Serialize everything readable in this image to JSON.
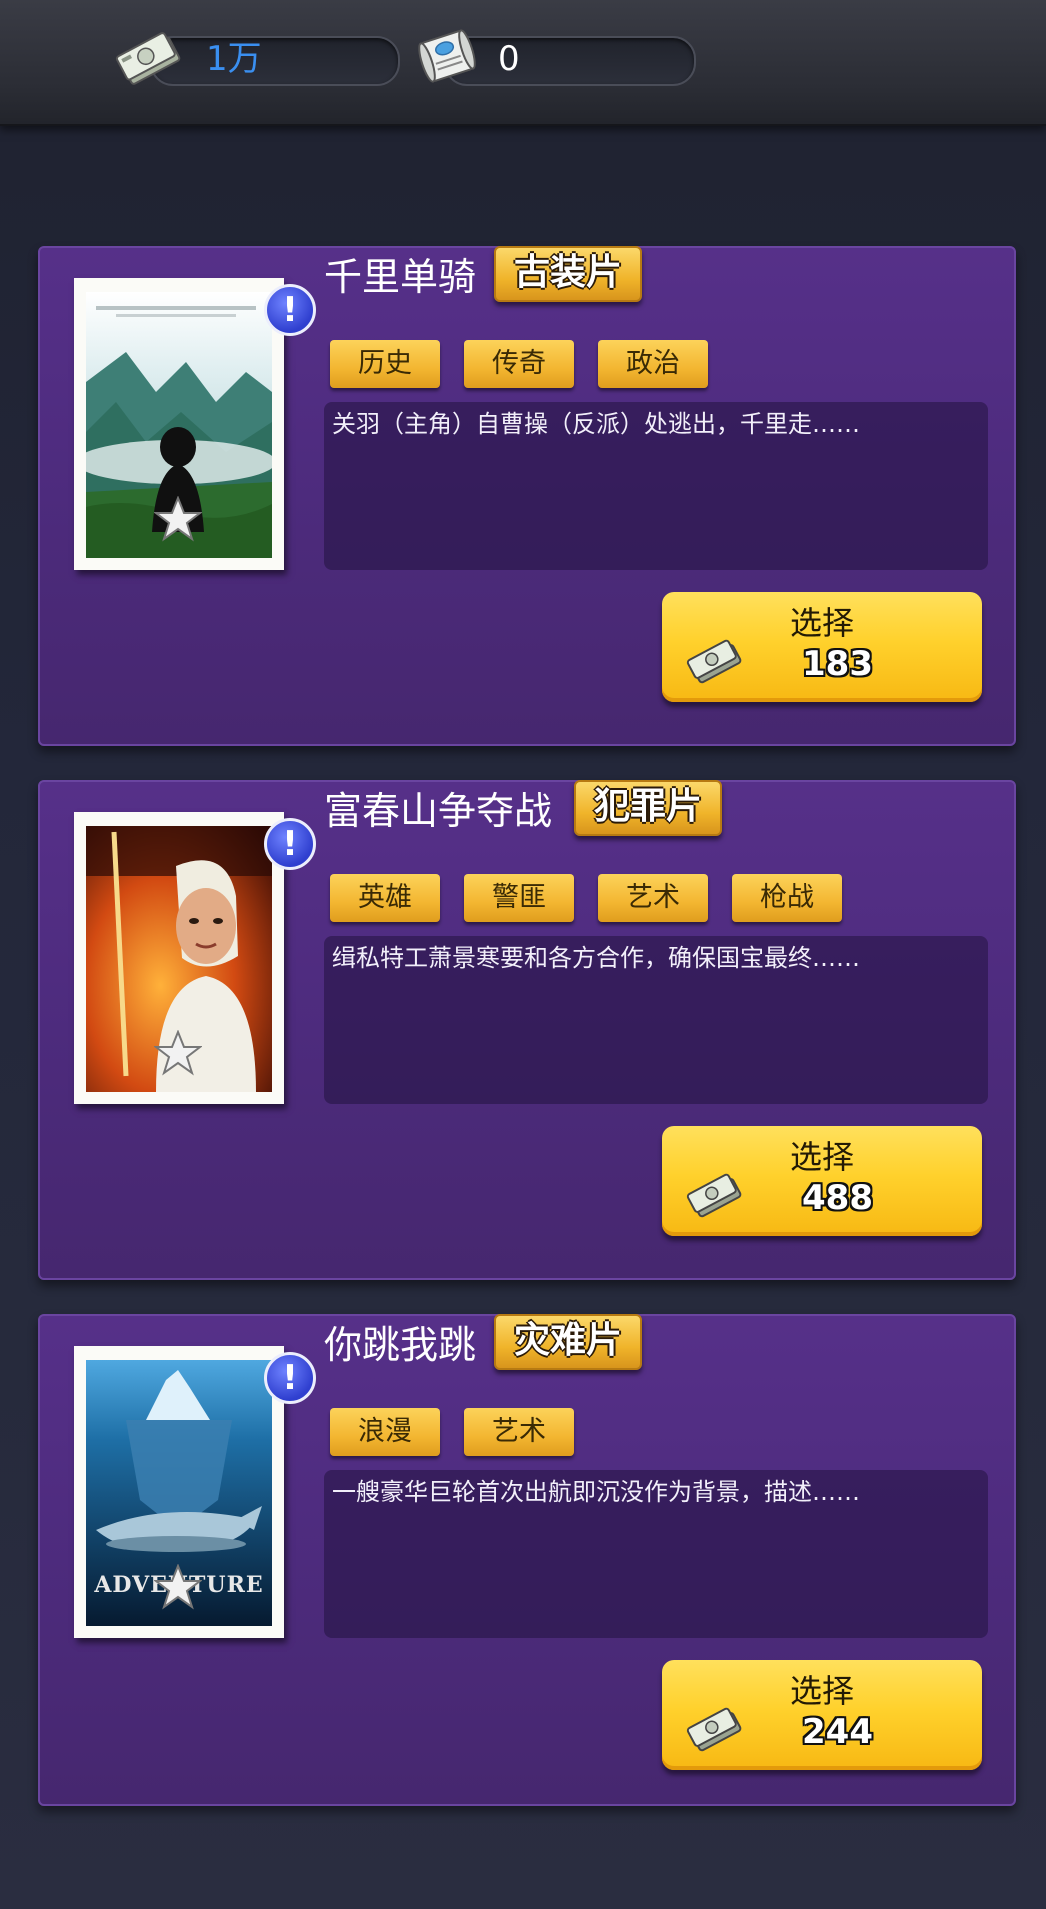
{
  "resources": {
    "money": "1万",
    "scripts": "0"
  },
  "movies": [
    {
      "title": "千里单骑",
      "genre": "古装片",
      "tags": [
        "历史",
        "传奇",
        "政治"
      ],
      "description": "关羽（主角）自曹操（反派）处逃出，千里走……",
      "select_label": "选择",
      "cost": "183",
      "poster_icon": "mountain-landscape-silhouette"
    },
    {
      "title": "富春山争夺战",
      "genre": "犯罪片",
      "tags": [
        "英雄",
        "警匪",
        "艺术",
        "枪战"
      ],
      "description": "缉私特工萧景寒要和各方合作，确保国宝最终……",
      "select_label": "选择",
      "cost": "488",
      "poster_icon": "swordsman-fire"
    },
    {
      "title": "你跳我跳",
      "genre": "灾难片",
      "tags": [
        "浪漫",
        "艺术"
      ],
      "description": "一艘豪华巨轮首次出航即沉没作为背景，描述……",
      "select_label": "选择",
      "cost": "244",
      "poster_icon": "iceberg-whale",
      "poster_text": "ADVENTURE"
    }
  ],
  "colors": {
    "card_purple": "#4d2b7d",
    "button_yellow": "#ffd12c",
    "badge_blue": "#3b4fe0",
    "money_text_blue": "#3a8ff0"
  }
}
